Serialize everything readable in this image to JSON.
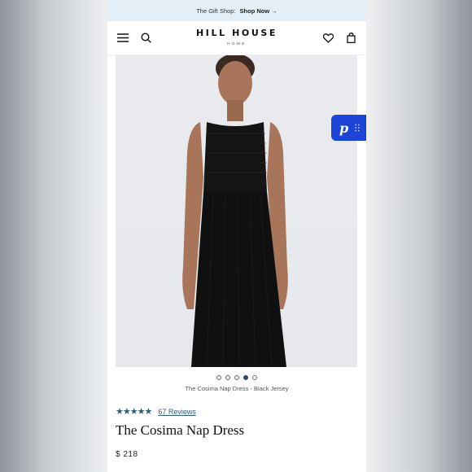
{
  "promo": {
    "text": "The Gift Shop:",
    "link": "Shop Now →"
  },
  "header": {
    "brand": "HILL HOUSE",
    "brand_sub": "HOME"
  },
  "gallery": {
    "caption": "The Cosima Nap Dress - Black Jersey",
    "dot_count": 5,
    "active_dot": 4
  },
  "product": {
    "rating_stars": "★★★★★",
    "reviews": "67 Reviews",
    "title": "The Cosima Nap Dress",
    "price": "$ 218"
  },
  "float_button": {
    "label": "p"
  },
  "colors": {
    "promo_bg": "#e3eef6",
    "accent": "#2e5e76",
    "float_btn": "#1c44d6"
  }
}
